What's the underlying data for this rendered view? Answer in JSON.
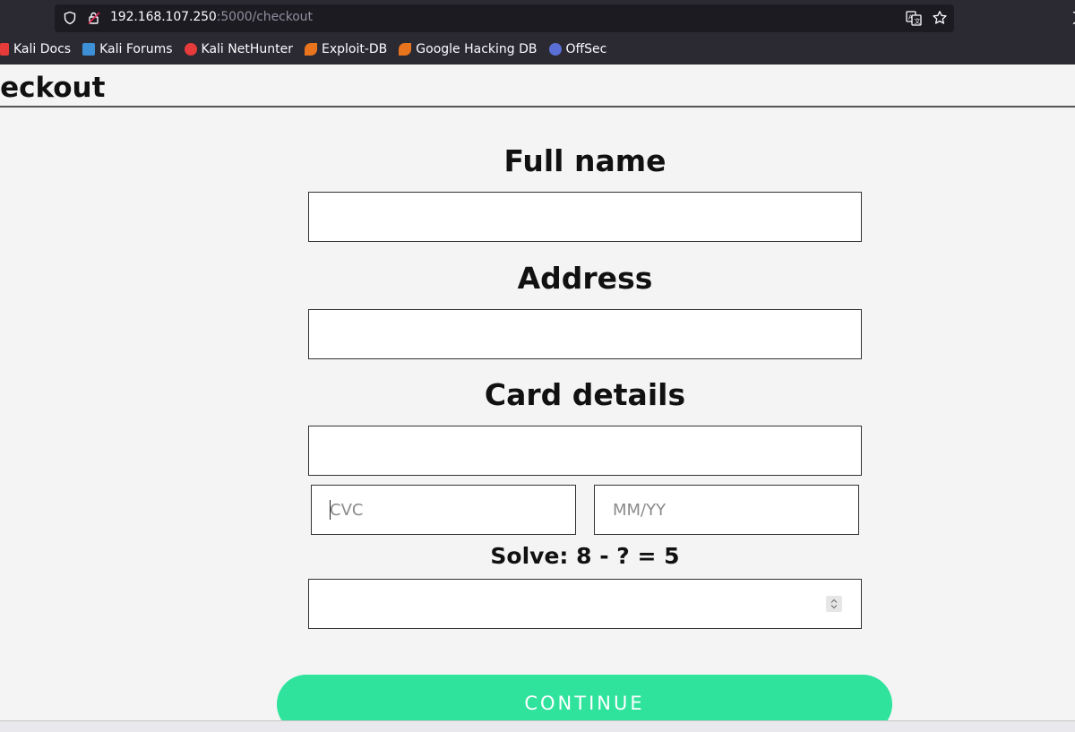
{
  "browser": {
    "url_host": "192.168.107.250",
    "url_path": ":5000/checkout",
    "bookmarks": [
      {
        "label": "Kali Docs",
        "icon": "kali-docs-icon",
        "color": "#e53b3b"
      },
      {
        "label": "Kali Forums",
        "icon": "kali-forums-icon",
        "color": "#3d8fd6"
      },
      {
        "label": "Kali NetHunter",
        "icon": "kali-nethunter-icon",
        "color": "#e53b3b"
      },
      {
        "label": "Exploit-DB",
        "icon": "exploit-db-icon",
        "color": "#e8741e"
      },
      {
        "label": "Google Hacking DB",
        "icon": "ghdb-icon",
        "color": "#e8741e"
      },
      {
        "label": "OffSec",
        "icon": "offsec-icon",
        "color": "#5a6fd6"
      }
    ]
  },
  "page": {
    "title": "heckout",
    "labels": {
      "full_name": "Full name",
      "address": "Address",
      "card_details": "Card details",
      "captcha": "Solve: 8 - ? = 5"
    },
    "fields": {
      "full_name": {
        "value": "",
        "placeholder": ""
      },
      "address": {
        "value": "",
        "placeholder": ""
      },
      "card_number": {
        "value": "",
        "placeholder": ""
      },
      "cvc": {
        "value": "",
        "placeholder": "CVC"
      },
      "expiry": {
        "value": "",
        "placeholder": "MM/YY"
      },
      "captcha": {
        "value": "",
        "placeholder": ""
      }
    },
    "continue_label": "CONTINUE",
    "accent_color": "#2fe39d"
  }
}
